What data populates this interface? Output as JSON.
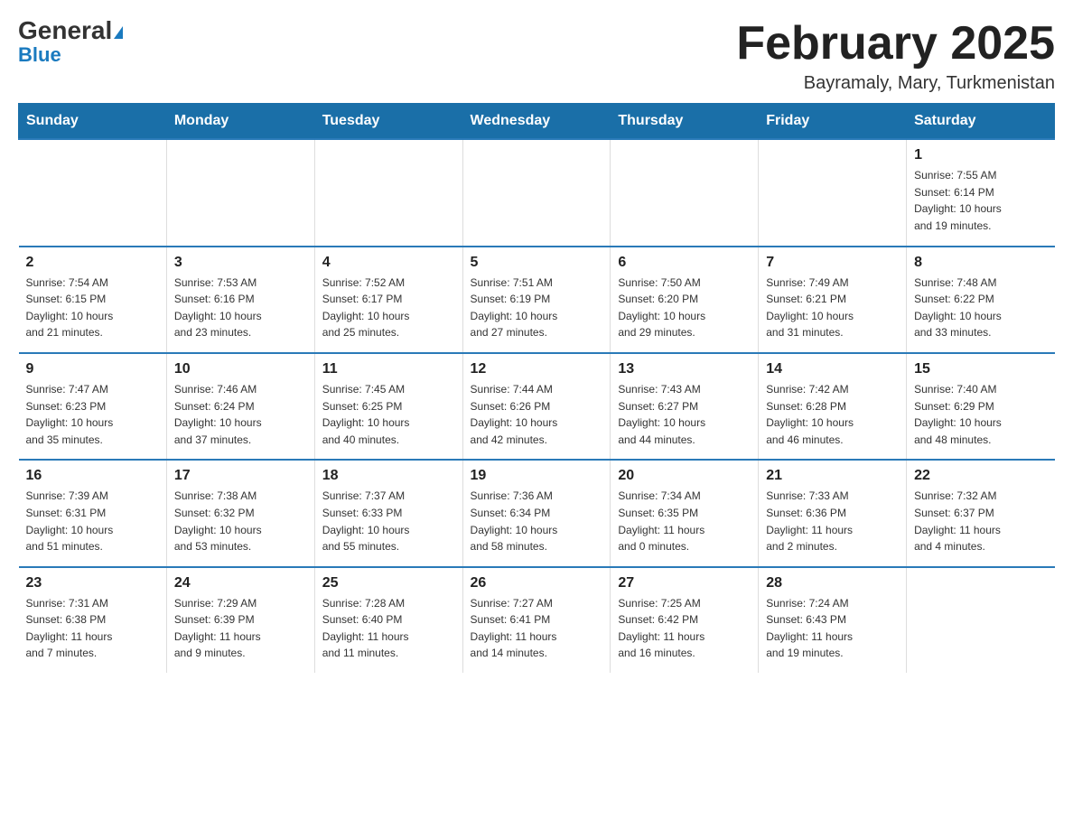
{
  "logo": {
    "general": "General",
    "blue": "Blue"
  },
  "title": "February 2025",
  "location": "Bayramaly, Mary, Turkmenistan",
  "days_of_week": [
    "Sunday",
    "Monday",
    "Tuesday",
    "Wednesday",
    "Thursday",
    "Friday",
    "Saturday"
  ],
  "weeks": [
    [
      {
        "day": "",
        "info": ""
      },
      {
        "day": "",
        "info": ""
      },
      {
        "day": "",
        "info": ""
      },
      {
        "day": "",
        "info": ""
      },
      {
        "day": "",
        "info": ""
      },
      {
        "day": "",
        "info": ""
      },
      {
        "day": "1",
        "info": "Sunrise: 7:55 AM\nSunset: 6:14 PM\nDaylight: 10 hours\nand 19 minutes."
      }
    ],
    [
      {
        "day": "2",
        "info": "Sunrise: 7:54 AM\nSunset: 6:15 PM\nDaylight: 10 hours\nand 21 minutes."
      },
      {
        "day": "3",
        "info": "Sunrise: 7:53 AM\nSunset: 6:16 PM\nDaylight: 10 hours\nand 23 minutes."
      },
      {
        "day": "4",
        "info": "Sunrise: 7:52 AM\nSunset: 6:17 PM\nDaylight: 10 hours\nand 25 minutes."
      },
      {
        "day": "5",
        "info": "Sunrise: 7:51 AM\nSunset: 6:19 PM\nDaylight: 10 hours\nand 27 minutes."
      },
      {
        "day": "6",
        "info": "Sunrise: 7:50 AM\nSunset: 6:20 PM\nDaylight: 10 hours\nand 29 minutes."
      },
      {
        "day": "7",
        "info": "Sunrise: 7:49 AM\nSunset: 6:21 PM\nDaylight: 10 hours\nand 31 minutes."
      },
      {
        "day": "8",
        "info": "Sunrise: 7:48 AM\nSunset: 6:22 PM\nDaylight: 10 hours\nand 33 minutes."
      }
    ],
    [
      {
        "day": "9",
        "info": "Sunrise: 7:47 AM\nSunset: 6:23 PM\nDaylight: 10 hours\nand 35 minutes."
      },
      {
        "day": "10",
        "info": "Sunrise: 7:46 AM\nSunset: 6:24 PM\nDaylight: 10 hours\nand 37 minutes."
      },
      {
        "day": "11",
        "info": "Sunrise: 7:45 AM\nSunset: 6:25 PM\nDaylight: 10 hours\nand 40 minutes."
      },
      {
        "day": "12",
        "info": "Sunrise: 7:44 AM\nSunset: 6:26 PM\nDaylight: 10 hours\nand 42 minutes."
      },
      {
        "day": "13",
        "info": "Sunrise: 7:43 AM\nSunset: 6:27 PM\nDaylight: 10 hours\nand 44 minutes."
      },
      {
        "day": "14",
        "info": "Sunrise: 7:42 AM\nSunset: 6:28 PM\nDaylight: 10 hours\nand 46 minutes."
      },
      {
        "day": "15",
        "info": "Sunrise: 7:40 AM\nSunset: 6:29 PM\nDaylight: 10 hours\nand 48 minutes."
      }
    ],
    [
      {
        "day": "16",
        "info": "Sunrise: 7:39 AM\nSunset: 6:31 PM\nDaylight: 10 hours\nand 51 minutes."
      },
      {
        "day": "17",
        "info": "Sunrise: 7:38 AM\nSunset: 6:32 PM\nDaylight: 10 hours\nand 53 minutes."
      },
      {
        "day": "18",
        "info": "Sunrise: 7:37 AM\nSunset: 6:33 PM\nDaylight: 10 hours\nand 55 minutes."
      },
      {
        "day": "19",
        "info": "Sunrise: 7:36 AM\nSunset: 6:34 PM\nDaylight: 10 hours\nand 58 minutes."
      },
      {
        "day": "20",
        "info": "Sunrise: 7:34 AM\nSunset: 6:35 PM\nDaylight: 11 hours\nand 0 minutes."
      },
      {
        "day": "21",
        "info": "Sunrise: 7:33 AM\nSunset: 6:36 PM\nDaylight: 11 hours\nand 2 minutes."
      },
      {
        "day": "22",
        "info": "Sunrise: 7:32 AM\nSunset: 6:37 PM\nDaylight: 11 hours\nand 4 minutes."
      }
    ],
    [
      {
        "day": "23",
        "info": "Sunrise: 7:31 AM\nSunset: 6:38 PM\nDaylight: 11 hours\nand 7 minutes."
      },
      {
        "day": "24",
        "info": "Sunrise: 7:29 AM\nSunset: 6:39 PM\nDaylight: 11 hours\nand 9 minutes."
      },
      {
        "day": "25",
        "info": "Sunrise: 7:28 AM\nSunset: 6:40 PM\nDaylight: 11 hours\nand 11 minutes."
      },
      {
        "day": "26",
        "info": "Sunrise: 7:27 AM\nSunset: 6:41 PM\nDaylight: 11 hours\nand 14 minutes."
      },
      {
        "day": "27",
        "info": "Sunrise: 7:25 AM\nSunset: 6:42 PM\nDaylight: 11 hours\nand 16 minutes."
      },
      {
        "day": "28",
        "info": "Sunrise: 7:24 AM\nSunset: 6:43 PM\nDaylight: 11 hours\nand 19 minutes."
      },
      {
        "day": "",
        "info": ""
      }
    ]
  ],
  "colors": {
    "header_bg": "#1a6fa8",
    "header_text": "#ffffff",
    "accent": "#1a7abf"
  }
}
